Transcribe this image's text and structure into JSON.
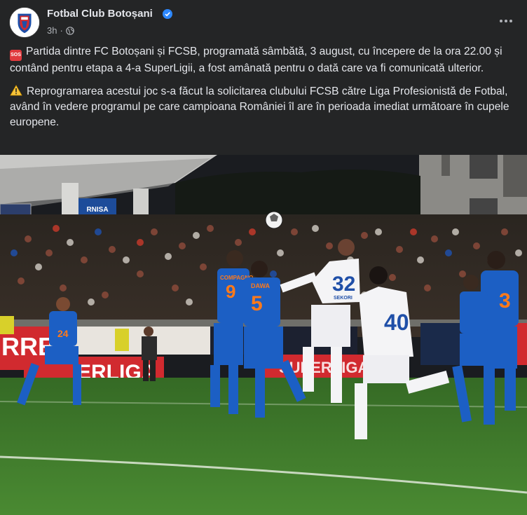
{
  "post": {
    "page_name": "Fotbal Club Botoșani",
    "time": "3h",
    "separator": "·",
    "verified_icon": "verified-badge-icon",
    "privacy_icon": "globe-icon",
    "more_icon": "more-options-icon",
    "paragraph_1": "Partida dintre FC Botoșani și FCSB, programată sâmbătă, 3 august, cu începere de la ora 22.00 și contând pentru etapa a 4-a SuperLigii, a fost amânată pentru o dată care va fi comunicată ulterior.",
    "paragraph_1_emoji": "SOS",
    "paragraph_2": "Reprogramarea acestui joc s-a făcut la solicitarea clubului FCSB către Liga Profesionistă de Fotbal, având în vedere programul pe care campioana României îl are în perioada imediat următoare în cupele europene.",
    "paragraph_2_emoji": "warning-icon"
  },
  "photo": {
    "players": {
      "p1_number": "24",
      "p2_name": "COMPAGNO",
      "p2_number": "9",
      "p3_name": "DAWA",
      "p3_number": "5",
      "p4_number": "32",
      "p4_name": "SEKORI",
      "p5_number": "40",
      "p6_number": "3"
    },
    "boards": {
      "left_board": "RRE",
      "superliga_left": "ERLIGA",
      "superliga_mid": "SUPERLIGA",
      "stand_banner": "RNISA"
    },
    "colors": {
      "home_kit": "#1c5fc4",
      "away_kit": "#f4f4f6",
      "pitch": "#3f7c2c",
      "board_red": "#d12a2f"
    }
  }
}
